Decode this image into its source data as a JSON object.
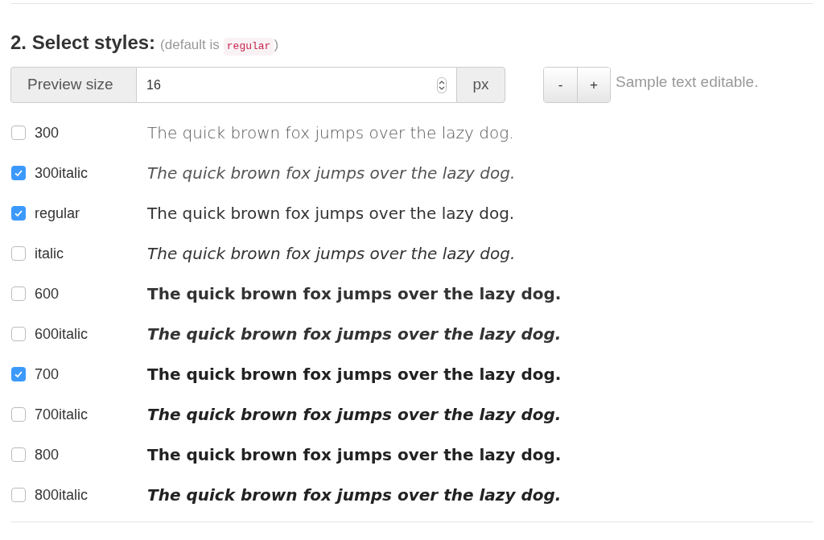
{
  "heading": {
    "title": "2. Select styles:",
    "note_before": "(default is",
    "note_code": "regular",
    "note_after": ")"
  },
  "preview": {
    "label": "Preview size",
    "value": "16",
    "unit": "px"
  },
  "size_buttons": [
    "-",
    "+"
  ],
  "sample_note": "Sample text editable.",
  "styles": [
    {
      "label": "300",
      "kind": "light",
      "italic": false,
      "checked": false,
      "sample": "The quick brown fox jumps over the lazy dog."
    },
    {
      "label": "300italic",
      "kind": "light",
      "italic": true,
      "checked": true,
      "sample": "The quick brown fox jumps over the lazy dog."
    },
    {
      "label": "regular",
      "kind": "regular",
      "italic": false,
      "checked": true,
      "sample": "The quick brown fox jumps over the lazy dog."
    },
    {
      "label": "italic",
      "kind": "regular",
      "italic": true,
      "checked": false,
      "sample": "The quick brown fox jumps over the lazy dog."
    },
    {
      "label": "600",
      "kind": "semibold",
      "italic": false,
      "checked": false,
      "sample": "The quick brown fox jumps over the lazy dog."
    },
    {
      "label": "600italic",
      "kind": "semibold",
      "italic": true,
      "checked": false,
      "sample": "The quick brown fox jumps over the lazy dog."
    },
    {
      "label": "700",
      "kind": "bold",
      "italic": false,
      "checked": true,
      "sample": "The quick brown fox jumps over the lazy dog."
    },
    {
      "label": "700italic",
      "kind": "bold",
      "italic": true,
      "checked": false,
      "sample": "The quick brown fox jumps over the lazy dog."
    },
    {
      "label": "800",
      "kind": "extrabold",
      "italic": false,
      "checked": false,
      "sample": "The quick brown fox jumps over the lazy dog."
    },
    {
      "label": "800italic",
      "kind": "extrabold",
      "italic": true,
      "checked": false,
      "sample": "The quick brown fox jumps over the lazy dog."
    }
  ]
}
